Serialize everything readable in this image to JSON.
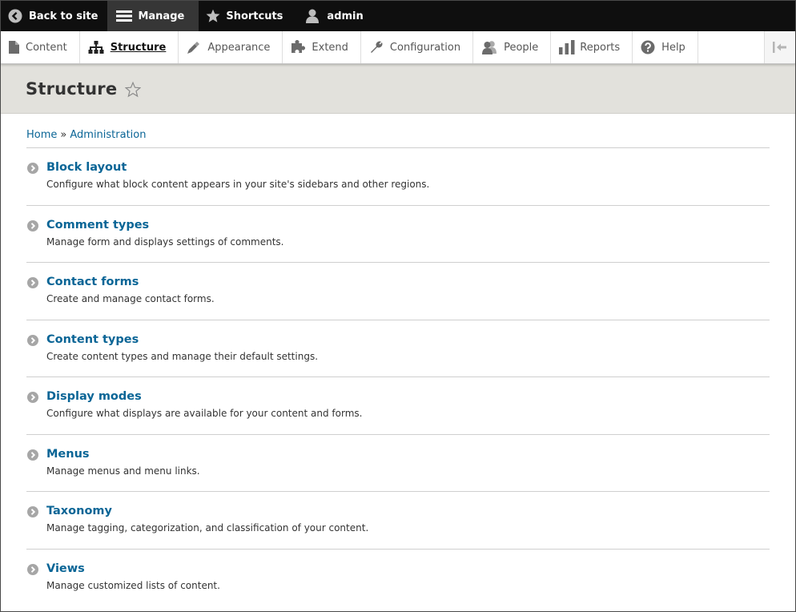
{
  "toolbar": {
    "back_label": "Back to site",
    "manage_label": "Manage",
    "shortcuts_label": "Shortcuts",
    "user_label": "admin"
  },
  "tray": {
    "items": [
      {
        "label": "Content",
        "icon": "file-icon"
      },
      {
        "label": "Structure",
        "icon": "sitemap-icon"
      },
      {
        "label": "Appearance",
        "icon": "brush-icon"
      },
      {
        "label": "Extend",
        "icon": "puzzle-icon"
      },
      {
        "label": "Configuration",
        "icon": "wrench-icon"
      },
      {
        "label": "People",
        "icon": "people-icon"
      },
      {
        "label": "Reports",
        "icon": "bar-chart-icon"
      },
      {
        "label": "Help",
        "icon": "help-icon"
      }
    ]
  },
  "page": {
    "title": "Structure"
  },
  "breadcrumb": {
    "home": "Home",
    "separator": "»",
    "administration": "Administration"
  },
  "admin_list": [
    {
      "title": "Block layout",
      "description": "Configure what block content appears in your site's sidebars and other regions."
    },
    {
      "title": "Comment types",
      "description": "Manage form and displays settings of comments."
    },
    {
      "title": "Contact forms",
      "description": "Create and manage contact forms."
    },
    {
      "title": "Content types",
      "description": "Create content types and manage their default settings."
    },
    {
      "title": "Display modes",
      "description": "Configure what displays are available for your content and forms."
    },
    {
      "title": "Menus",
      "description": "Manage menus and menu links."
    },
    {
      "title": "Taxonomy",
      "description": "Manage tagging, categorization, and classification of your content."
    },
    {
      "title": "Views",
      "description": "Manage customized lists of content."
    }
  ],
  "colors": {
    "link": "#0a6596",
    "toolbar_bg": "#0f0f0f",
    "header_bg": "#e2e1dc"
  }
}
